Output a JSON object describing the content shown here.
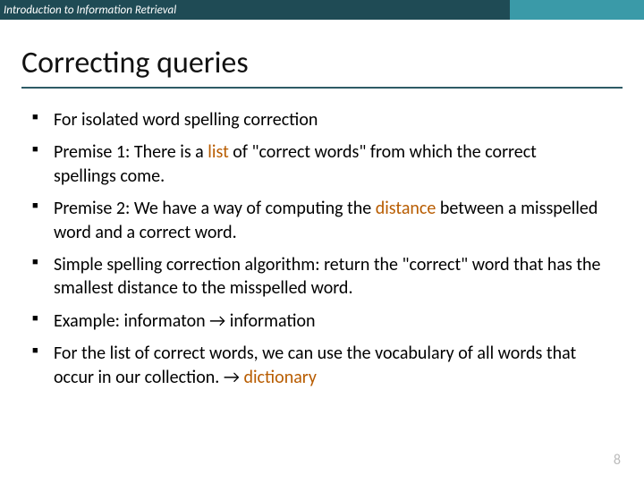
{
  "header": {
    "course": "Introduction to Information Retrieval"
  },
  "title": "Correcting queries",
  "bullets": [
    {
      "pre": "For isolated word spelling correction",
      "hl": "",
      "post": ""
    },
    {
      "pre": "Premise 1: There is a ",
      "hl": "list",
      "post": " of \"correct words\" from which the correct spellings come."
    },
    {
      "pre": "Premise 2: We have a way of computing the ",
      "hl": "distance",
      "post": " between a misspelled word and a correct word."
    },
    {
      "pre": "Simple spelling correction algorithm: return the \"correct\" word that has the smallest distance to the misspelled word.",
      "hl": "",
      "post": ""
    },
    {
      "pre": "Example: informaton → information",
      "hl": "",
      "post": ""
    },
    {
      "pre": "For the list of correct words, we can use the vocabulary of all words that occur in our collection. → ",
      "hl": "dictionary",
      "post": ""
    }
  ],
  "page": "8"
}
